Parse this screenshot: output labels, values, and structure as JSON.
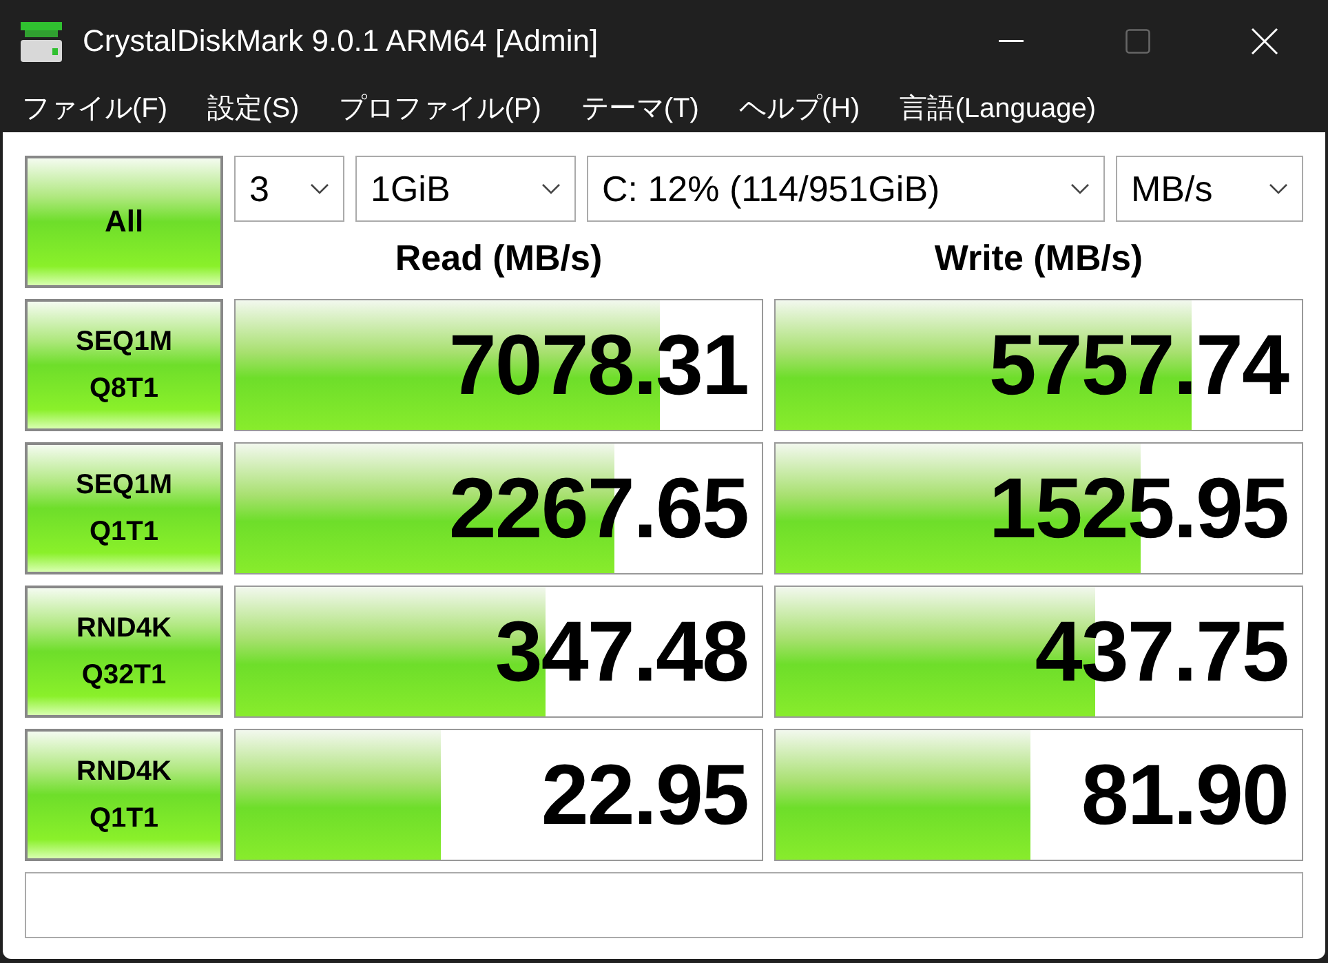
{
  "window": {
    "title": "CrystalDiskMark 9.0.1 ARM64 [Admin]",
    "maximize_disabled": true
  },
  "menu": [
    "ファイル(F)",
    "設定(S)",
    "プロファイル(P)",
    "テーマ(T)",
    "ヘルプ(H)",
    "言語(Language)"
  ],
  "all_button": "All",
  "selects": [
    {
      "value": "3"
    },
    {
      "value": "1GiB"
    },
    {
      "value": "C: 12% (114/951GiB)"
    },
    {
      "value": "MB/s"
    }
  ],
  "headers": {
    "read": "Read (MB/s)",
    "write": "Write (MB/s)"
  },
  "tests": [
    {
      "line1": "SEQ1M",
      "line2": "Q8T1",
      "read": {
        "value": "7078.31",
        "level": 0.807
      },
      "write": {
        "value": "5757.74",
        "level": 0.79
      }
    },
    {
      "line1": "SEQ1M",
      "line2": "Q1T1",
      "read": {
        "value": "2267.65",
        "level": 0.72
      },
      "write": {
        "value": "1525.95",
        "level": 0.695
      }
    },
    {
      "line1": "RND4K",
      "line2": "Q32T1",
      "read": {
        "value": "347.48",
        "level": 0.59
      },
      "write": {
        "value": "437.75",
        "level": 0.607
      }
    },
    {
      "line1": "RND4K",
      "line2": "Q1T1",
      "read": {
        "value": "22.95",
        "level": 0.39
      },
      "write": {
        "value": "81.90",
        "level": 0.484
      }
    }
  ]
}
